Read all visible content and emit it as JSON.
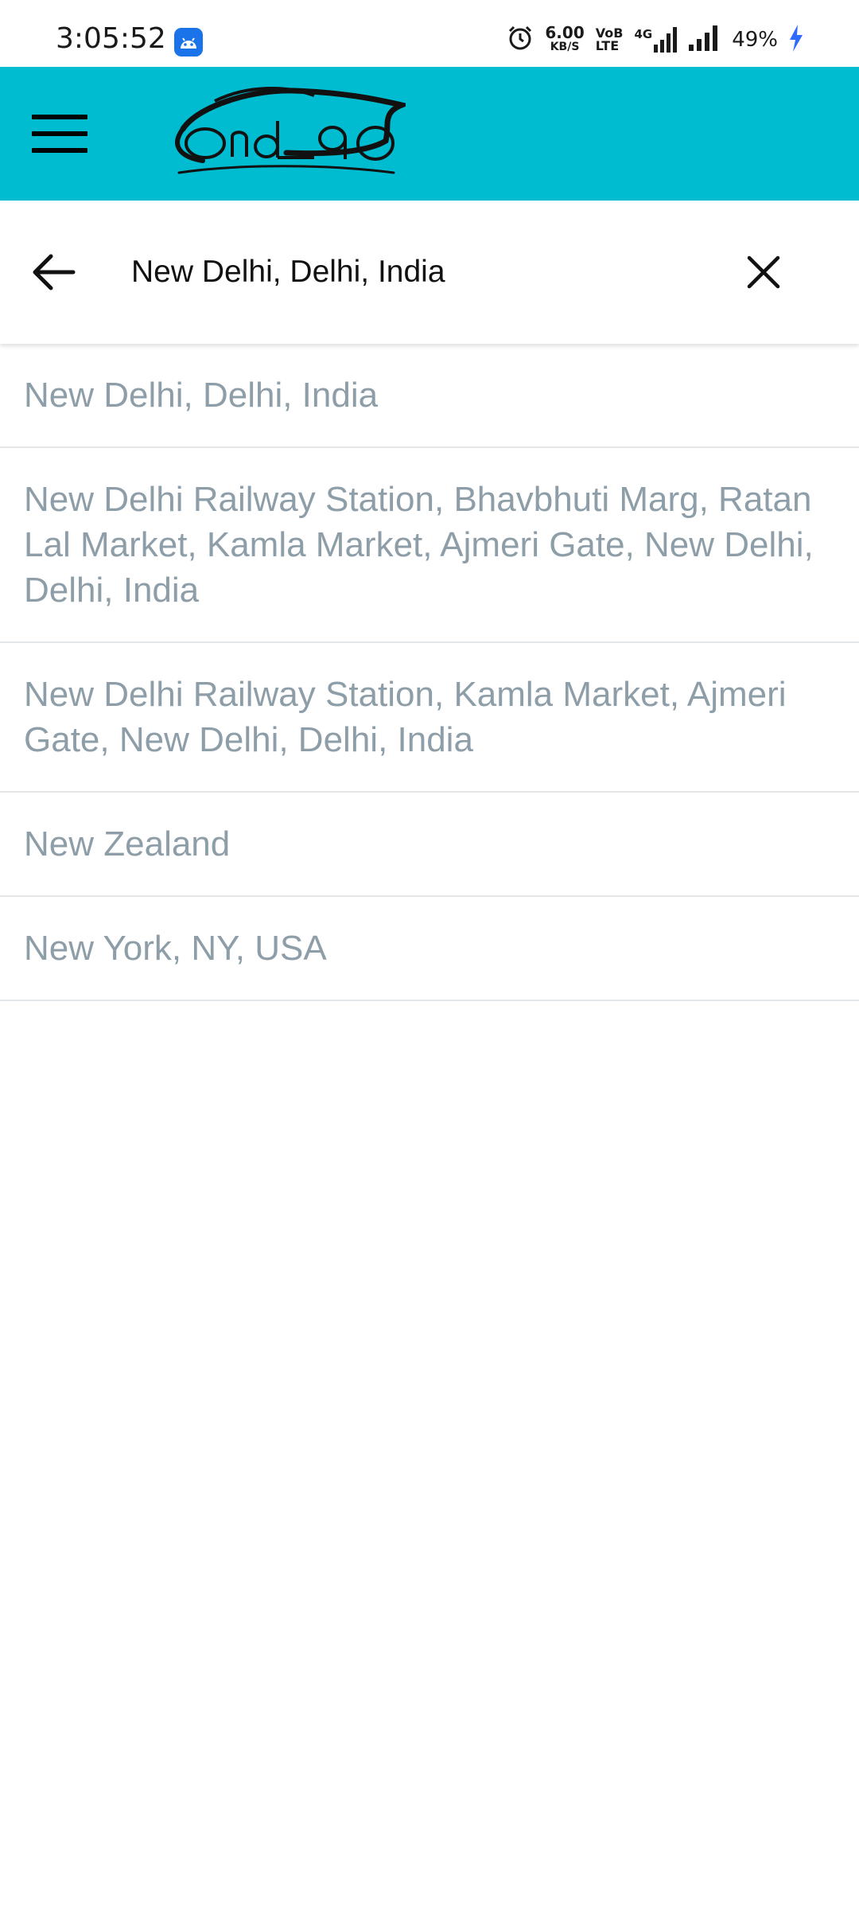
{
  "status_bar": {
    "time": "3:05:52",
    "net_speed_value": "6.00",
    "net_speed_unit": "KB/S",
    "volte_top": "VoB",
    "volte_bottom": "LTE",
    "network_label": "4G",
    "battery": "49%"
  },
  "app_bar": {
    "logo_text": "Ond gO",
    "menu_icon": "hamburger-menu-icon"
  },
  "search": {
    "value": "New Delhi, Delhi, India",
    "back_icon": "arrow-left-icon",
    "clear_icon": "close-icon"
  },
  "suggestions": [
    {
      "label": "New Delhi, Delhi, India"
    },
    {
      "label": "New Delhi Railway Station, Bhavbhuti Marg, Ratan Lal Market, Kamla Market, Ajmeri Gate, New Delhi, Delhi, India"
    },
    {
      "label": "New Delhi Railway Station, Kamla Market, Ajmeri Gate, New Delhi, Delhi, India"
    },
    {
      "label": "New Zealand"
    },
    {
      "label": "New York, NY, USA"
    }
  ],
  "colors": {
    "app_bar": "#00bcd0",
    "suggestion_text": "#8e9ea8",
    "divider": "#e3e6e8"
  }
}
